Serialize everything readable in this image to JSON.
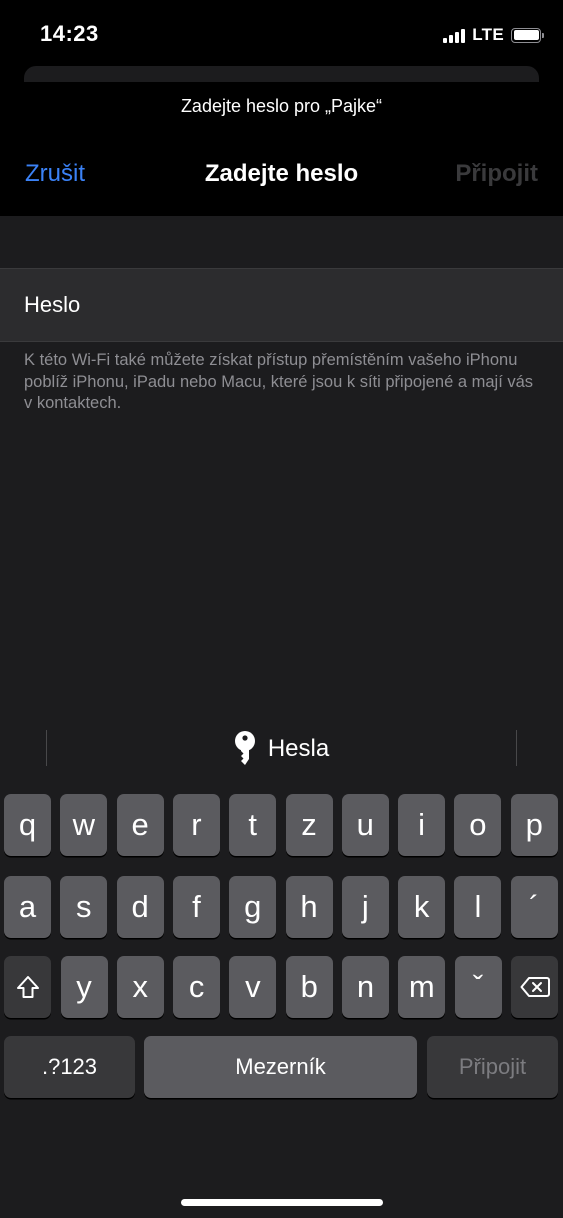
{
  "status_bar": {
    "time": "14:23",
    "network": "LTE",
    "battery_level": 0.9
  },
  "sheet": {
    "prompt": "Zadejte heslo pro „Pajke“",
    "nav": {
      "cancel_label": "Zrušit",
      "title": "Zadejte heslo",
      "join_label": "Připojit"
    },
    "password_field": {
      "placeholder": "Heslo",
      "value": ""
    },
    "footnote": "K této Wi-Fi také můžete získat přístup přemístěním vašeho iPhonu poblíž iPhonu, iPadu nebo Macu, které jsou k síti připojené a mají vás v kontaktech."
  },
  "keyboard": {
    "suggestion": {
      "label": "Hesla",
      "icon": "key-icon"
    },
    "row1": [
      "q",
      "w",
      "e",
      "r",
      "t",
      "z",
      "u",
      "i",
      "o",
      "p"
    ],
    "row2": [
      "a",
      "s",
      "d",
      "f",
      "g",
      "h",
      "j",
      "k",
      "l",
      "´"
    ],
    "row3": [
      "y",
      "x",
      "c",
      "v",
      "b",
      "n",
      "m",
      "ˇ"
    ],
    "numbers_label": ".?123",
    "space_label": "Mezerník",
    "return_label": "Připojit"
  },
  "colors": {
    "accent": "#3b82f6",
    "background": "#1c1c1e",
    "key": "#5b5b5f",
    "key_dark": "#38383a"
  }
}
